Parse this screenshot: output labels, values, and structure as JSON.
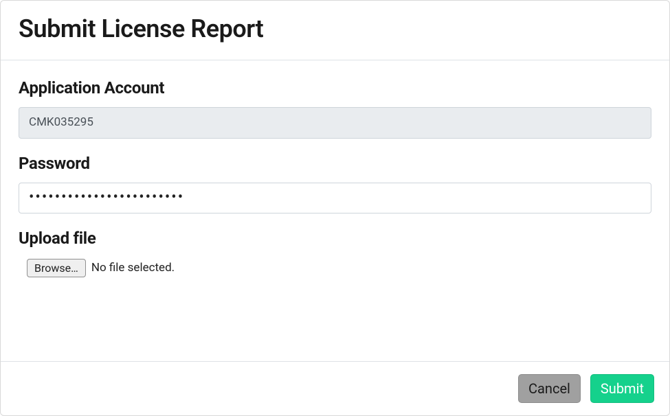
{
  "modal": {
    "title": "Submit License Report"
  },
  "form": {
    "account": {
      "label": "Application Account",
      "value": "CMK035295"
    },
    "password": {
      "label": "Password",
      "value": "••••••••••••••••••••••••"
    },
    "upload": {
      "label": "Upload file",
      "browse_label": "Browse…",
      "status": "No file selected."
    }
  },
  "footer": {
    "cancel_label": "Cancel",
    "submit_label": "Submit"
  }
}
